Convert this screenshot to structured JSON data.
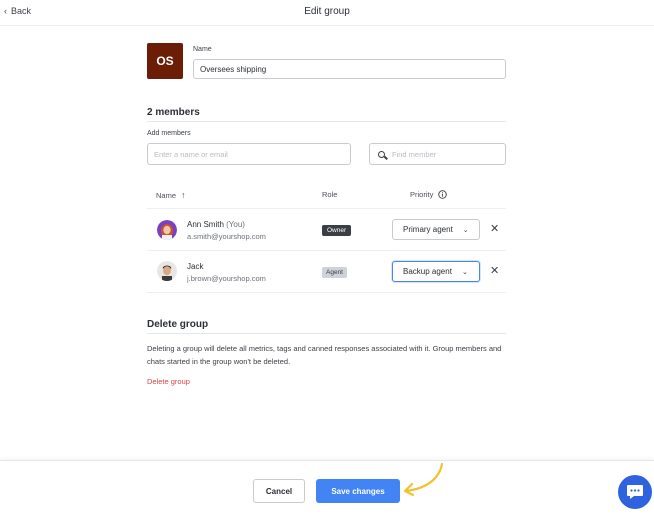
{
  "header": {
    "back_label": "Back",
    "title": "Edit group"
  },
  "group": {
    "initials": "OS",
    "avatar_color": "#6b1d06",
    "name_label": "Name",
    "name_value": "Oversees shipping"
  },
  "members_section": {
    "title": "2 members",
    "add_label": "Add members",
    "add_placeholder": "Enter a name or email",
    "find_placeholder": "Find member",
    "columns": {
      "name": "Name",
      "role": "Role",
      "priority": "Priority"
    },
    "members": [
      {
        "name": "Ann Smith",
        "suffix": "(You)",
        "email": "a.smith@yourshop.com",
        "role": "Owner",
        "priority": "Primary agent"
      },
      {
        "name": "Jack",
        "suffix": "",
        "email": "j.brown@yourshop.com",
        "role": "Agent",
        "priority": "Backup agent"
      }
    ]
  },
  "delete_section": {
    "title": "Delete group",
    "description": "Deleting a group will delete all metrics, tags and canned responses associated with it. Group members and chats started in the group won't be deleted.",
    "link_label": "Delete group"
  },
  "footer": {
    "cancel_label": "Cancel",
    "save_label": "Save changes"
  },
  "colors": {
    "accent": "#4384f5",
    "danger": "#d64646",
    "arrow": "#f2c12e",
    "chat_button": "#2f62df"
  }
}
